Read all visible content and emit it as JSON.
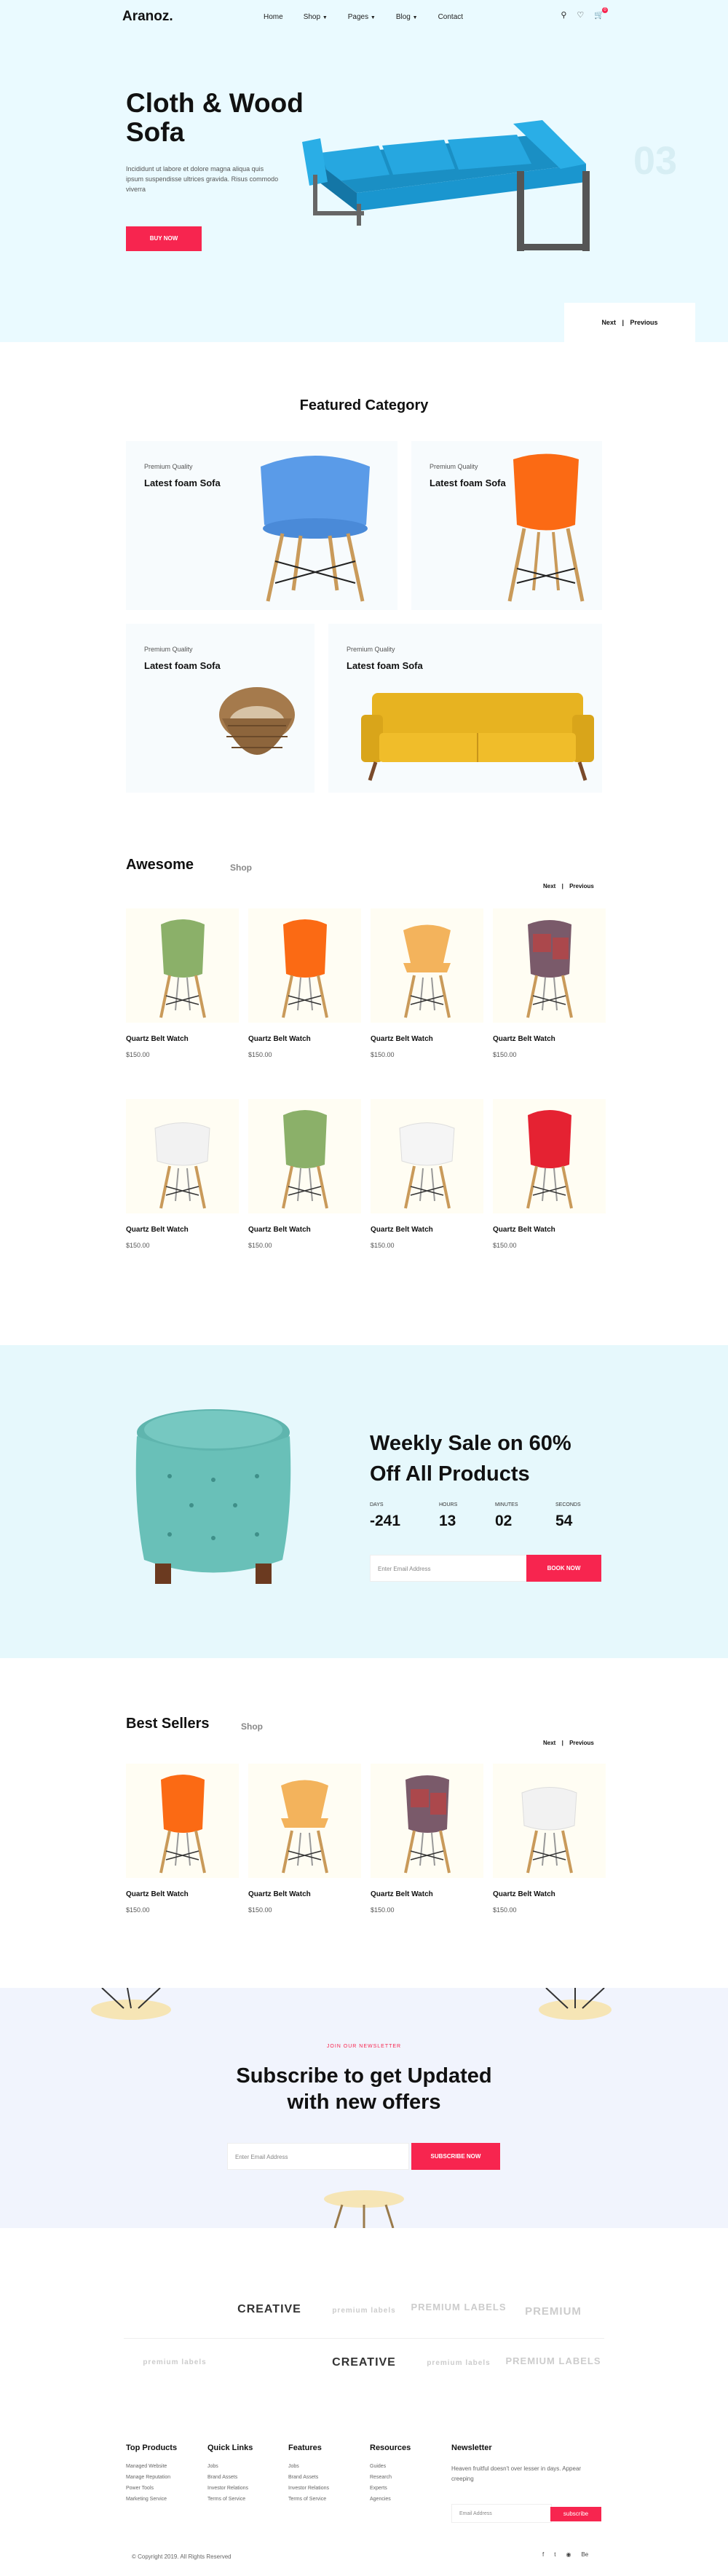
{
  "header": {
    "logo": "Aranoz.",
    "menu": [
      "Home",
      "Shop",
      "Pages",
      "Blog",
      "Contact"
    ],
    "menu_dropdown": [
      false,
      true,
      true,
      true,
      false
    ],
    "cart_count": "0"
  },
  "hero": {
    "title": "Cloth & Wood Sofa",
    "description": "Incididunt ut labore et dolore magna aliqua quis ipsum suspendisse ultrices gravida. Risus commodo viverra",
    "button": "BUY NOW",
    "slide_number": "03",
    "next": "Next",
    "previous": "Previous",
    "sofa_color": "#1e9fd8"
  },
  "featured": {
    "title": "Featured Category",
    "cards": [
      {
        "tag": "Premium Quality",
        "name": "Latest foam Sofa"
      },
      {
        "tag": "Premium Quality",
        "name": "Latest foam Sofa"
      },
      {
        "tag": "Premium Quality",
        "name": "Latest foam Sofa"
      },
      {
        "tag": "Premium Quality",
        "name": "Latest foam Sofa"
      }
    ]
  },
  "awesome": {
    "title": "Awesome",
    "subtitle": "Shop",
    "next": "Next",
    "previous": "Previous",
    "products": [
      {
        "name": "Quartz Belt Watch",
        "price": "$150.00",
        "color": "#8bb069"
      },
      {
        "name": "Quartz Belt Watch",
        "price": "$150.00",
        "color": "#fb6a14"
      },
      {
        "name": "Quartz Belt Watch",
        "price": "$150.00",
        "color": "#f3b35c"
      },
      {
        "name": "Quartz Belt Watch",
        "price": "$150.00",
        "color": "#7a5a6a"
      },
      {
        "name": "Quartz Belt Watch",
        "price": "$150.00",
        "color": "#f2f2f2"
      },
      {
        "name": "Quartz Belt Watch",
        "price": "$150.00",
        "color": "#8bb069"
      },
      {
        "name": "Quartz Belt Watch",
        "price": "$150.00",
        "color": "#f5f5f5"
      },
      {
        "name": "Quartz Belt Watch",
        "price": "$150.00",
        "color": "#e52232"
      }
    ]
  },
  "sale": {
    "title": "Weekly Sale on 60% Off All Products",
    "countdown": [
      {
        "label": "DAYS",
        "value": "-241"
      },
      {
        "label": "HOURS",
        "value": "13"
      },
      {
        "label": "MINUTES",
        "value": "02"
      },
      {
        "label": "SECONDS",
        "value": "54"
      }
    ],
    "email_placeholder": "Enter Email Address",
    "button": "BOOK NOW"
  },
  "best": {
    "title": "Best Sellers",
    "subtitle": "Shop",
    "next": "Next",
    "previous": "Previous",
    "products": [
      {
        "name": "Quartz Belt Watch",
        "price": "$150.00",
        "color": "#fb6a14"
      },
      {
        "name": "Quartz Belt Watch",
        "price": "$150.00",
        "color": "#f3b35c"
      },
      {
        "name": "Quartz Belt Watch",
        "price": "$150.00",
        "color": "#7a5a6a"
      },
      {
        "name": "Quartz Belt Watch",
        "price": "$150.00",
        "color": "#f2f2f2"
      }
    ]
  },
  "newsletter": {
    "kicker": "JOIN OUR NEWSLETTER",
    "title": "Subscribe to get Updated with new offers",
    "placeholder": "Enter Email Address",
    "button": "SUBSCRIBE NOW"
  },
  "brands": [
    "CREATIVE",
    "premium labels",
    "PREMIUM LABELS",
    "PREMIUM",
    "premium labels",
    "CREATIVE",
    "premium labels",
    "PREMIUM LABELS"
  ],
  "footer": {
    "cols": [
      {
        "title": "Top Products",
        "links": [
          "Managed Website",
          "Manage Reputation",
          "Power Tools",
          "Marketing Service"
        ]
      },
      {
        "title": "Quick Links",
        "links": [
          "Jobs",
          "Brand Assets",
          "Investor Relations",
          "Terms of Service"
        ]
      },
      {
        "title": "Features",
        "links": [
          "Jobs",
          "Brand Assets",
          "Investor Relations",
          "Terms of Service"
        ]
      },
      {
        "title": "Resources",
        "links": [
          "Guides",
          "Research",
          "Experts",
          "Agencies"
        ]
      }
    ],
    "newsletter_title": "Newsletter",
    "newsletter_text": "Heaven fruitful doesn't over lesser in days. Appear creeping",
    "email_placeholder": "Email Address",
    "subscribe": "subscribe",
    "copyright": "© Copyright 2019. All Rights Reserved"
  },
  "colors": {
    "accent": "#f7254f",
    "hero_bg": "#eafaff"
  }
}
